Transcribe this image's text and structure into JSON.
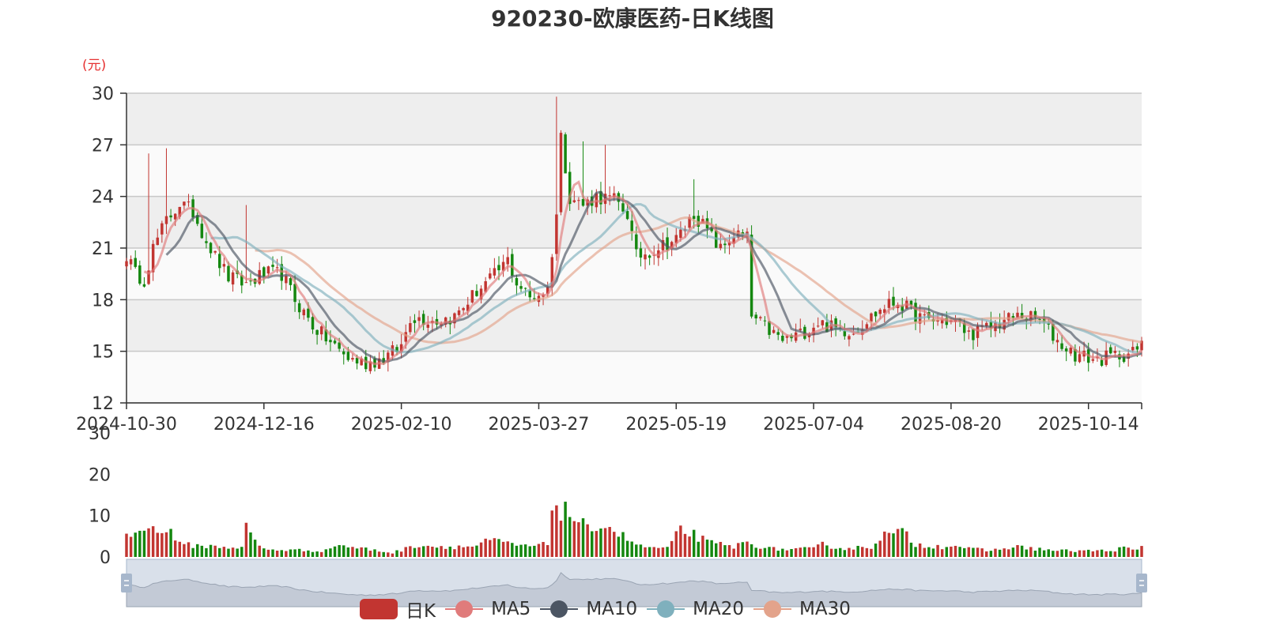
{
  "title": "920230-欧康医药-日K线图",
  "unit": "(元)",
  "colors": {
    "up": "#c23531",
    "down": "#14870f",
    "ma5": "#e07b7b",
    "ma10": "#4b5563",
    "ma20": "#7fb0bd",
    "ma30": "#e3a38b",
    "grid": "#c8c8c8",
    "band_dark": "#eeeeee",
    "band_light": "#fafafa",
    "axis": "#333333",
    "slider_bg": "#d9e0ea"
  },
  "legend": [
    {
      "label": "日K",
      "key": "kline",
      "color": "#c23531"
    },
    {
      "label": "MA5",
      "key": "ma5",
      "color": "#e07b7b"
    },
    {
      "label": "MA10",
      "key": "ma10",
      "color": "#4b5563"
    },
    {
      "label": "MA20",
      "key": "ma20",
      "color": "#7fb0bd"
    },
    {
      "label": "MA30",
      "key": "ma30",
      "color": "#e3a38b"
    }
  ],
  "chart_data": [
    {
      "type": "candlestick",
      "title": "920230-欧康医药-日K线图",
      "ylabel": "(元)",
      "ylim": [
        12,
        30
      ],
      "yticks": [
        12,
        15,
        18,
        21,
        24,
        27,
        30
      ],
      "xticks": [
        "2024-10-30",
        "2024-12-16",
        "2025-02-10",
        "2025-03-27",
        "2025-05-19",
        "2025-07-04",
        "2025-08-20",
        "2025-10-14"
      ],
      "xtick_index": [
        0,
        31,
        62,
        93,
        124,
        155,
        186,
        217
      ],
      "num_days": 230,
      "grid": true,
      "price_keypoints": [
        [
          0,
          20.6
        ],
        [
          2,
          19.5
        ],
        [
          4,
          19.2
        ],
        [
          6,
          21.0
        ],
        [
          9,
          22.6
        ],
        [
          12,
          23.6
        ],
        [
          15,
          23.1
        ],
        [
          17,
          22.0
        ],
        [
          20,
          20.5
        ],
        [
          23,
          19.3
        ],
        [
          27,
          18.9
        ],
        [
          31,
          19.5
        ],
        [
          35,
          19.5
        ],
        [
          38,
          18.0
        ],
        [
          42,
          16.5
        ],
        [
          46,
          15.5
        ],
        [
          50,
          14.6
        ],
        [
          54,
          14.3
        ],
        [
          58,
          14.6
        ],
        [
          62,
          15.3
        ],
        [
          64,
          17.0
        ],
        [
          67,
          16.9
        ],
        [
          70,
          16.8
        ],
        [
          74,
          17.0
        ],
        [
          79,
          18.5
        ],
        [
          83,
          19.4
        ],
        [
          86,
          20.3
        ],
        [
          88,
          19.0
        ],
        [
          91,
          18.1
        ],
        [
          95,
          18.6
        ],
        [
          97,
          23.0
        ],
        [
          98,
          27.5
        ],
        [
          100,
          24.0
        ],
        [
          103,
          23.5
        ],
        [
          106,
          24.0
        ],
        [
          110,
          23.8
        ],
        [
          113,
          23.0
        ],
        [
          115,
          20.5
        ],
        [
          118,
          20.8
        ],
        [
          121,
          21.2
        ],
        [
          124,
          21.5
        ],
        [
          128,
          23.0
        ],
        [
          131,
          22.0
        ],
        [
          134,
          20.9
        ],
        [
          137,
          21.8
        ],
        [
          140,
          21.6
        ],
        [
          141,
          17.0
        ],
        [
          144,
          16.4
        ],
        [
          148,
          15.6
        ],
        [
          152,
          16.0
        ],
        [
          156,
          16.7
        ],
        [
          160,
          16.3
        ],
        [
          164,
          16.2
        ],
        [
          168,
          17.0
        ],
        [
          171,
          17.6
        ],
        [
          174,
          17.9
        ],
        [
          177,
          17.3
        ],
        [
          180,
          16.8
        ],
        [
          184,
          16.8
        ],
        [
          187,
          16.7
        ],
        [
          190,
          16.0
        ],
        [
          194,
          16.3
        ],
        [
          198,
          16.8
        ],
        [
          202,
          17.1
        ],
        [
          206,
          16.8
        ],
        [
          210,
          15.6
        ],
        [
          214,
          14.8
        ],
        [
          219,
          14.5
        ],
        [
          224,
          14.8
        ],
        [
          227,
          14.9
        ],
        [
          229,
          15.3
        ]
      ],
      "spikes": [
        [
          5,
          26.5
        ],
        [
          9,
          26.8
        ],
        [
          27,
          23.5
        ],
        [
          97,
          29.8
        ],
        [
          103,
          27.2
        ],
        [
          108,
          27.0
        ],
        [
          128,
          25.0
        ]
      ],
      "volume": {
        "ylim": [
          0,
          30
        ],
        "yticks": [
          0,
          10,
          20,
          30
        ],
        "keypoints": [
          [
            0,
            6
          ],
          [
            3,
            5.5
          ],
          [
            5,
            9
          ],
          [
            8,
            5
          ],
          [
            10,
            7
          ],
          [
            12,
            3
          ],
          [
            20,
            2.5
          ],
          [
            26,
            2.3
          ],
          [
            27,
            7
          ],
          [
            29,
            4
          ],
          [
            31,
            1.8
          ],
          [
            45,
            1.5
          ],
          [
            47,
            3
          ],
          [
            60,
            1
          ],
          [
            66,
            3
          ],
          [
            70,
            2.5
          ],
          [
            78,
            2.5
          ],
          [
            82,
            4
          ],
          [
            90,
            2.5
          ],
          [
            95,
            3
          ],
          [
            96,
            13.5
          ],
          [
            98,
            11.5
          ],
          [
            102,
            9
          ],
          [
            105,
            5
          ],
          [
            107,
            9
          ],
          [
            112,
            5
          ],
          [
            116,
            2.5
          ],
          [
            122,
            2
          ],
          [
            125,
            6.5
          ],
          [
            128,
            5.5
          ],
          [
            131,
            3.5
          ],
          [
            134,
            3
          ],
          [
            137,
            2.5
          ],
          [
            140,
            3.5
          ],
          [
            145,
            2
          ],
          [
            150,
            1.8
          ],
          [
            155,
            2
          ],
          [
            157,
            3
          ],
          [
            162,
            2
          ],
          [
            168,
            2.5
          ],
          [
            170,
            5
          ],
          [
            175,
            6
          ],
          [
            178,
            3
          ],
          [
            184,
            2.5
          ],
          [
            186,
            3
          ],
          [
            190,
            2
          ],
          [
            195,
            1.5
          ],
          [
            200,
            2.5
          ],
          [
            210,
            1.5
          ],
          [
            222,
            1.5
          ],
          [
            225,
            2.2
          ],
          [
            228,
            1.5
          ],
          [
            229,
            2.5
          ]
        ]
      }
    }
  ]
}
